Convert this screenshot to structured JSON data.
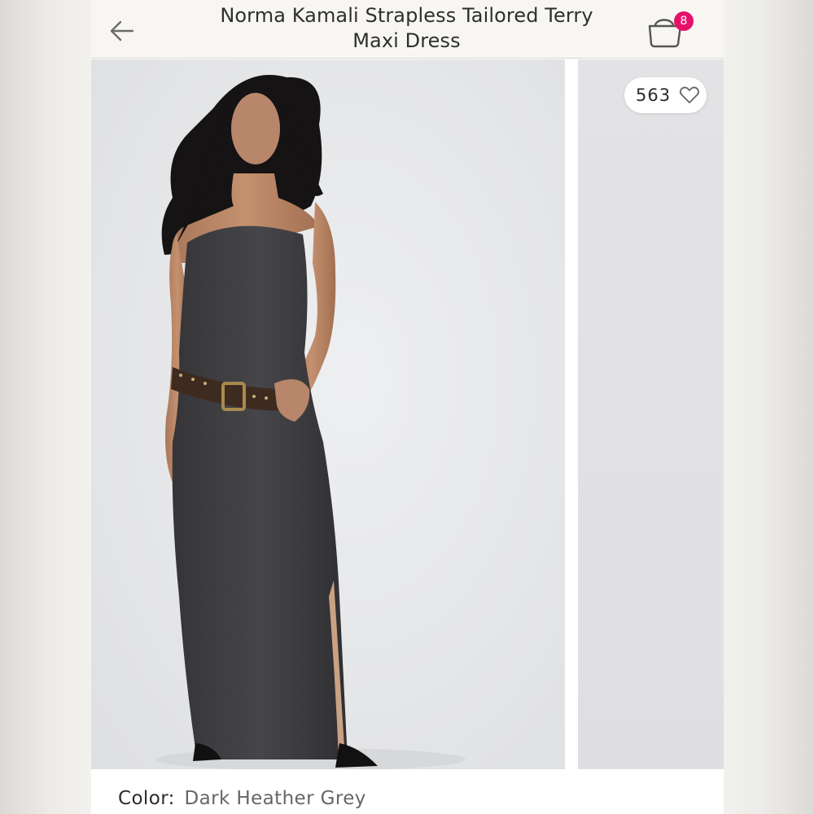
{
  "header": {
    "title": "Norma Kamali Strapless Tailored Terry Maxi Dress",
    "bag_count": "8",
    "back_icon": "arrow-left-icon",
    "bag_icon": "shopping-bag-icon"
  },
  "gallery": {
    "like_count": "563",
    "like_icon": "heart-outline-icon",
    "main_image": "model wearing strapless maxi dress"
  },
  "product": {
    "color_label": "Color:",
    "color_value": "Dark Heather Grey"
  },
  "colors": {
    "badge": "#e4106a",
    "header_bg": "#f8f6f2",
    "dress": "#3f3f42"
  }
}
